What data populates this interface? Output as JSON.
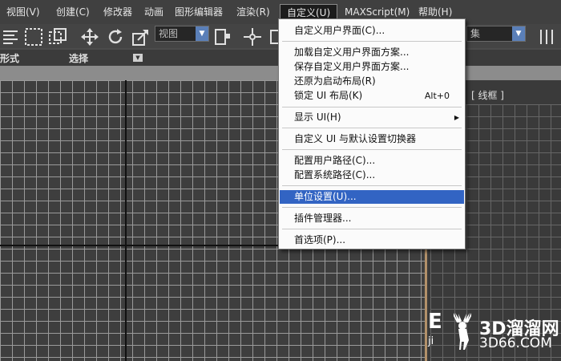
{
  "menubar": {
    "items": [
      "视图(V)",
      "创建(C)",
      "修改器",
      "动画",
      "图形编辑器",
      "渲染(R)",
      "自定义(U)",
      "MAXScript(M)",
      "帮助(H)"
    ]
  },
  "toolbar": {
    "view_combo": "视图",
    "selection_set_combo": "集"
  },
  "ribbon": {
    "left_label": "形式",
    "select_label": "选择"
  },
  "viewport": {
    "label": "[ 线框 ]"
  },
  "dropdown": {
    "items": [
      {
        "label": "自定义用户界面(C)...",
        "shortcut": ""
      },
      {
        "label": "加载自定义用户界面方案...",
        "shortcut": ""
      },
      {
        "label": "保存自定义用户界面方案...",
        "shortcut": ""
      },
      {
        "label": "还原为启动布局(R)",
        "shortcut": ""
      },
      {
        "label": "锁定 UI 布局(K)",
        "shortcut": "Alt+0"
      },
      {
        "label": "显示 UI(H)",
        "shortcut": ""
      },
      {
        "label": "自定义 UI 与默认设置切换器",
        "shortcut": ""
      },
      {
        "label": "配置用户路径(C)...",
        "shortcut": ""
      },
      {
        "label": "配置系统路径(C)...",
        "shortcut": ""
      },
      {
        "label": "单位设置(U)...",
        "shortcut": ""
      },
      {
        "label": "插件管理器...",
        "shortcut": ""
      },
      {
        "label": "首选项(P)...",
        "shortcut": ""
      }
    ],
    "selected_index": 9
  },
  "watermark": {
    "title": "3D溜溜网",
    "url": "3D66.COM",
    "left_big": "E",
    "left_small": "ji"
  },
  "colors": {
    "highlight": "#3264c3",
    "frame_border": "#b3916a"
  }
}
